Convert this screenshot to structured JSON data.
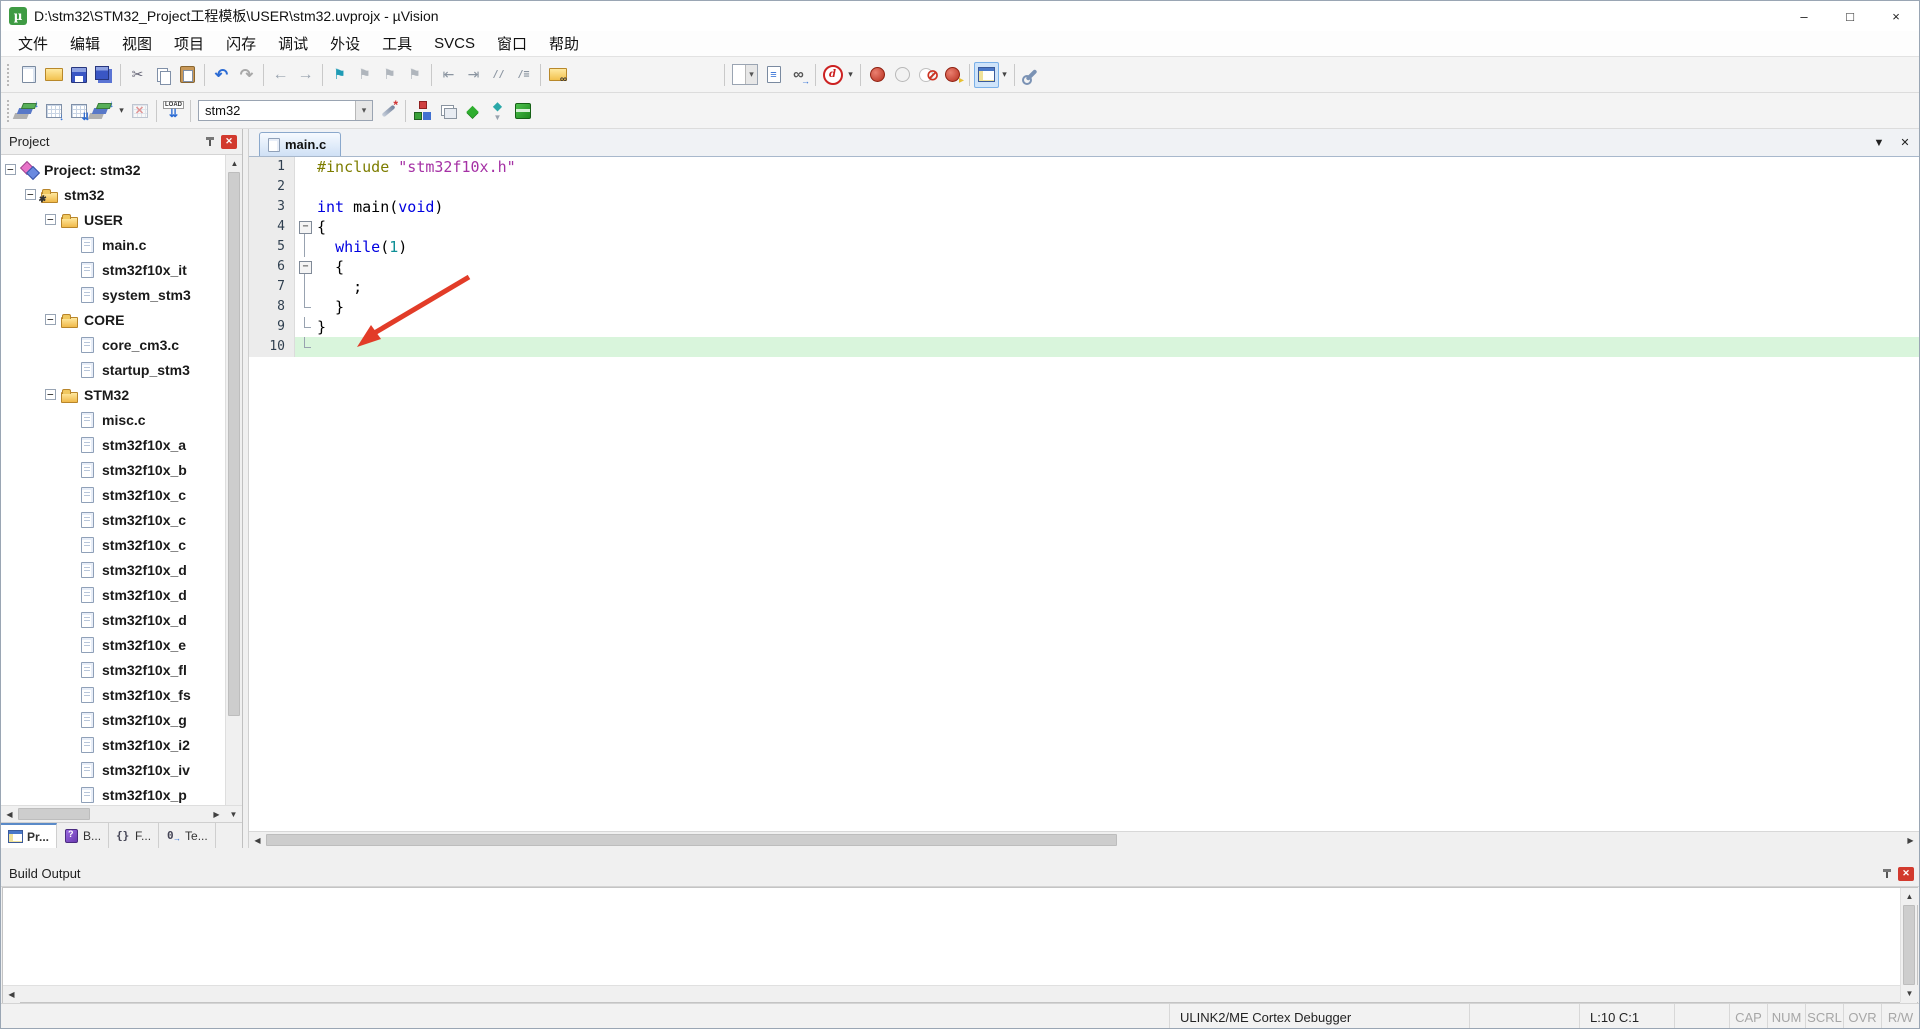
{
  "window": {
    "title": "D:\\stm32\\STM32_Project工程模板\\USER\\stm32.uvprojx - µVision",
    "controls": [
      {
        "name": "minimize-button",
        "glyph": "–"
      },
      {
        "name": "maximize-button",
        "glyph": "□"
      },
      {
        "name": "close-button",
        "glyph": "×"
      }
    ]
  },
  "menu": [
    "文件",
    "编辑",
    "视图",
    "项目",
    "闪存",
    "调试",
    "外设",
    "工具",
    "SVCS",
    "窗口",
    "帮助"
  ],
  "toolbar_main": {
    "groups": [
      [
        {
          "n": "new-file"
        },
        {
          "n": "open-file"
        },
        {
          "n": "save-file"
        },
        {
          "n": "save-all"
        }
      ],
      [
        {
          "n": "cut"
        },
        {
          "n": "copy"
        },
        {
          "n": "paste"
        }
      ],
      [
        {
          "n": "undo"
        },
        {
          "n": "redo"
        }
      ],
      [
        {
          "n": "nav-back"
        },
        {
          "n": "nav-forward"
        }
      ],
      [
        {
          "n": "bookmark-toggle"
        },
        {
          "n": "bookmark-prev"
        },
        {
          "n": "bookmark-next"
        },
        {
          "n": "bookmark-clear"
        }
      ],
      [
        {
          "n": "outdent"
        },
        {
          "n": "indent"
        },
        {
          "n": "comment"
        },
        {
          "n": "uncomment"
        }
      ],
      [
        {
          "n": "find-in-files"
        },
        {
          "sp": 150
        }
      ],
      [
        {
          "n": "search-combo",
          "combo": "",
          "w": 26
        },
        {
          "n": "browse-info"
        },
        {
          "n": "find-next"
        }
      ],
      [
        {
          "n": "debug-session",
          "arrow": true
        }
      ],
      [
        {
          "n": "bp-toggle"
        },
        {
          "n": "bp-disable"
        },
        {
          "n": "bp-kill"
        },
        {
          "n": "bp-enable-all"
        }
      ],
      [
        {
          "n": "window-layout",
          "hl": true,
          "arrow": true
        }
      ],
      [
        {
          "n": "configure"
        }
      ]
    ]
  },
  "toolbar_build": {
    "groups": [
      [
        {
          "n": "translate"
        },
        {
          "n": "build"
        },
        {
          "n": "rebuild"
        },
        {
          "n": "batch-build",
          "arrow": true
        },
        {
          "n": "stop-build",
          "dis": true
        }
      ],
      [
        {
          "n": "download-load"
        }
      ],
      [
        {
          "n": "target-combo",
          "combo": "stm32",
          "w": 175
        },
        {
          "n": "options-wand"
        }
      ],
      [
        {
          "n": "manage-items"
        },
        {
          "n": "file-ext"
        },
        {
          "n": "manage-rte"
        },
        {
          "n": "select-packs"
        },
        {
          "n": "pack-installer"
        }
      ]
    ]
  },
  "project": {
    "title": "Project",
    "tree": [
      {
        "label": "Project: stm32",
        "level": 0,
        "icon": "target",
        "expander": true
      },
      {
        "label": "stm32",
        "level": 1,
        "icon": "folder-gear",
        "expander": true
      },
      {
        "label": "USER",
        "level": 2,
        "icon": "folder",
        "expander": true
      },
      {
        "label": "main.c",
        "level": 3,
        "icon": "file"
      },
      {
        "label": "stm32f10x_it",
        "level": 3,
        "icon": "file"
      },
      {
        "label": "system_stm3",
        "level": 3,
        "icon": "file"
      },
      {
        "label": "CORE",
        "level": 2,
        "icon": "folder",
        "expander": true
      },
      {
        "label": "core_cm3.c",
        "level": 3,
        "icon": "file"
      },
      {
        "label": "startup_stm3",
        "level": 3,
        "icon": "file"
      },
      {
        "label": "STM32",
        "level": 2,
        "icon": "folder",
        "expander": true
      },
      {
        "label": "misc.c",
        "level": 3,
        "icon": "file"
      },
      {
        "label": "stm32f10x_a",
        "level": 3,
        "icon": "file"
      },
      {
        "label": "stm32f10x_b",
        "level": 3,
        "icon": "file"
      },
      {
        "label": "stm32f10x_c",
        "level": 3,
        "icon": "file"
      },
      {
        "label": "stm32f10x_c",
        "level": 3,
        "icon": "file"
      },
      {
        "label": "stm32f10x_c",
        "level": 3,
        "icon": "file"
      },
      {
        "label": "stm32f10x_d",
        "level": 3,
        "icon": "file"
      },
      {
        "label": "stm32f10x_d",
        "level": 3,
        "icon": "file"
      },
      {
        "label": "stm32f10x_d",
        "level": 3,
        "icon": "file"
      },
      {
        "label": "stm32f10x_e",
        "level": 3,
        "icon": "file"
      },
      {
        "label": "stm32f10x_fl",
        "level": 3,
        "icon": "file"
      },
      {
        "label": "stm32f10x_fs",
        "level": 3,
        "icon": "file"
      },
      {
        "label": "stm32f10x_g",
        "level": 3,
        "icon": "file"
      },
      {
        "label": "stm32f10x_i2",
        "level": 3,
        "icon": "file"
      },
      {
        "label": "stm32f10x_iv",
        "level": 3,
        "icon": "file"
      },
      {
        "label": "stm32f10x_p",
        "level": 3,
        "icon": "file"
      }
    ],
    "bottom_tabs": [
      {
        "label": "Pr...",
        "icon": "project",
        "active": true
      },
      {
        "label": "B...",
        "icon": "books",
        "active": false
      },
      {
        "label": "F...",
        "icon": "functions",
        "active": false
      },
      {
        "label": "Te...",
        "icon": "templates",
        "active": false
      }
    ]
  },
  "editor": {
    "tab_label": "main.c",
    "lines": [
      {
        "n": 1,
        "fold": "",
        "segs": [
          {
            "t": "#include ",
            "c": "pre"
          },
          {
            "t": "\"stm32f10x.h\"",
            "c": "str"
          }
        ]
      },
      {
        "n": 2,
        "fold": "",
        "segs": []
      },
      {
        "n": 3,
        "fold": "",
        "segs": [
          {
            "t": "int",
            "c": "kw"
          },
          {
            "t": " main(",
            "c": "pln"
          },
          {
            "t": "void",
            "c": "kw"
          },
          {
            "t": ")",
            "c": "pln"
          }
        ]
      },
      {
        "n": 4,
        "fold": "minus",
        "segs": [
          {
            "t": "{",
            "c": "pln"
          }
        ]
      },
      {
        "n": 5,
        "fold": "v",
        "segs": [
          {
            "t": "  ",
            "c": "pln"
          },
          {
            "t": "while",
            "c": "kw"
          },
          {
            "t": "(",
            "c": "pln"
          },
          {
            "t": "1",
            "c": "num"
          },
          {
            "t": ")",
            "c": "pln"
          }
        ]
      },
      {
        "n": 6,
        "fold": "minus",
        "segs": [
          {
            "t": "  {",
            "c": "pln"
          }
        ]
      },
      {
        "n": 7,
        "fold": "v",
        "segs": [
          {
            "t": "    ;",
            "c": "pln"
          }
        ]
      },
      {
        "n": 8,
        "fold": "end",
        "segs": [
          {
            "t": "  }",
            "c": "pln"
          }
        ]
      },
      {
        "n": 9,
        "fold": "end",
        "segs": [
          {
            "t": "}",
            "c": "pln"
          }
        ]
      },
      {
        "n": 10,
        "fold": "end",
        "segs": [],
        "highlight": true
      }
    ]
  },
  "build_output": {
    "title": "Build Output",
    "content": ""
  },
  "status": {
    "debugger": "ULINK2/ME Cortex Debugger",
    "cursor": "L:10 C:1",
    "flags": [
      "CAP",
      "NUM",
      "SCRL",
      "OVR",
      "R/W"
    ]
  },
  "colors": {
    "highlight_line": "#d9f5dc",
    "arrow_annotation": "#e23c28",
    "keyword": "#0000e0",
    "string": "#a531a5",
    "preprocessor": "#7d7d00",
    "number": "#0e8f96"
  }
}
